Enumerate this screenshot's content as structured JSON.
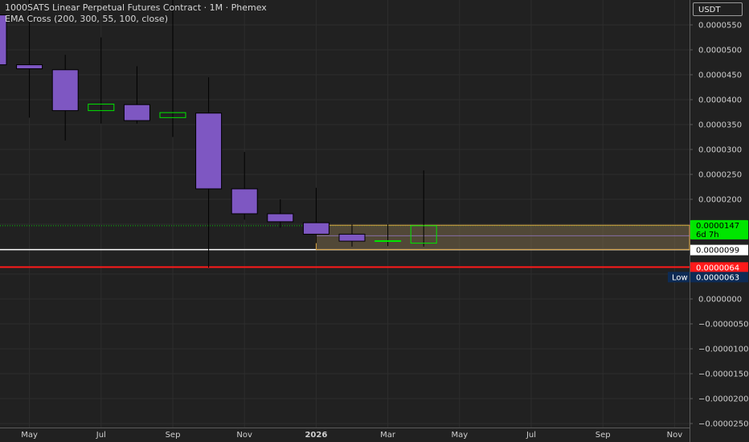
{
  "legend": {
    "title": "1000SATS Linear Perpetual Futures Contract · 1M · Phemex",
    "indicator": "EMA Cross (200, 300, 55, 100, close)"
  },
  "currency_button": "USDT",
  "colors": {
    "background": "#212121",
    "bear_fill": "#7e57c2",
    "bull_border": "#00e600",
    "wick": "#000000",
    "zone_border": "#d9a441",
    "zone_fill": "#7a6a4a",
    "current_price": "#00e600",
    "low_line": "#ff1a1a",
    "low_badge": "#0d2b55"
  },
  "price_axis": {
    "ticks": [
      "0.0000550",
      "0.0000500",
      "0.0000450",
      "0.0000400",
      "0.0000350",
      "0.0000300",
      "0.0000250",
      "0.0000200",
      "0.0000150",
      "0.0000100",
      "0.0000050",
      "0.0000000",
      "−0.0000050",
      "−0.0000100",
      "−0.0000150",
      "−0.0000200",
      "−0.0000250"
    ],
    "min": -2.5e-05,
    "max": 5.5e-05,
    "labels": {
      "current_price": "0.0000147",
      "countdown": "6d 7h",
      "white_level": "0.0000099",
      "red_level": "0.0000064",
      "low_tag": "Low",
      "low_value": "0.0000063"
    }
  },
  "time_axis": {
    "labels": [
      "May",
      "Jul",
      "Sep",
      "Nov",
      "2026",
      "Mar",
      "May",
      "Jul",
      "Sep",
      "Nov"
    ]
  },
  "chart_data": {
    "type": "candlestick",
    "interval": "1M",
    "x": [
      "2025-04",
      "2025-05",
      "2025-06",
      "2025-07",
      "2025-08",
      "2025-09",
      "2025-10",
      "2025-11",
      "2025-12",
      "2026-01",
      "2026-02",
      "2026-03",
      "2026-04"
    ],
    "open": [
      5.7e-05,
      4.7e-05,
      4.6e-05,
      3.78e-05,
      3.9e-05,
      3.64e-05,
      3.73e-05,
      2.21e-05,
      1.71e-05,
      1.53e-05,
      1.3e-05,
      1.17e-05,
      1.12e-05
    ],
    "high": [
      6e-05,
      6e-05,
      4.9e-05,
      5.25e-05,
      4.67e-05,
      6e-05,
      4.45e-05,
      2.95e-05,
      2e-05,
      2.23e-05,
      1.5e-05,
      1.5e-05,
      2.58e-05
    ],
    "low": [
      3.65e-05,
      3.64e-05,
      3.18e-05,
      3.52e-05,
      3.52e-05,
      3.25e-05,
      6.3e-06,
      1.59e-05,
      1.43e-05,
      1.12e-05,
      1.05e-05,
      1.06e-05,
      1.05e-05
    ],
    "close": [
      4.7e-05,
      4.62e-05,
      3.78e-05,
      3.91e-05,
      3.58e-05,
      3.74e-05,
      2.21e-05,
      1.71e-05,
      1.55e-05,
      1.3e-05,
      1.16e-05,
      1.17e-05,
      1.47e-05
    ],
    "levels": {
      "current_price": 1.47e-05,
      "white_line": 9.9e-06,
      "red_line": 6.4e-06,
      "low": 6.3e-06
    },
    "zone": {
      "top": 1.48e-05,
      "bottom": 9.9e-06,
      "from": "2026-01"
    }
  }
}
